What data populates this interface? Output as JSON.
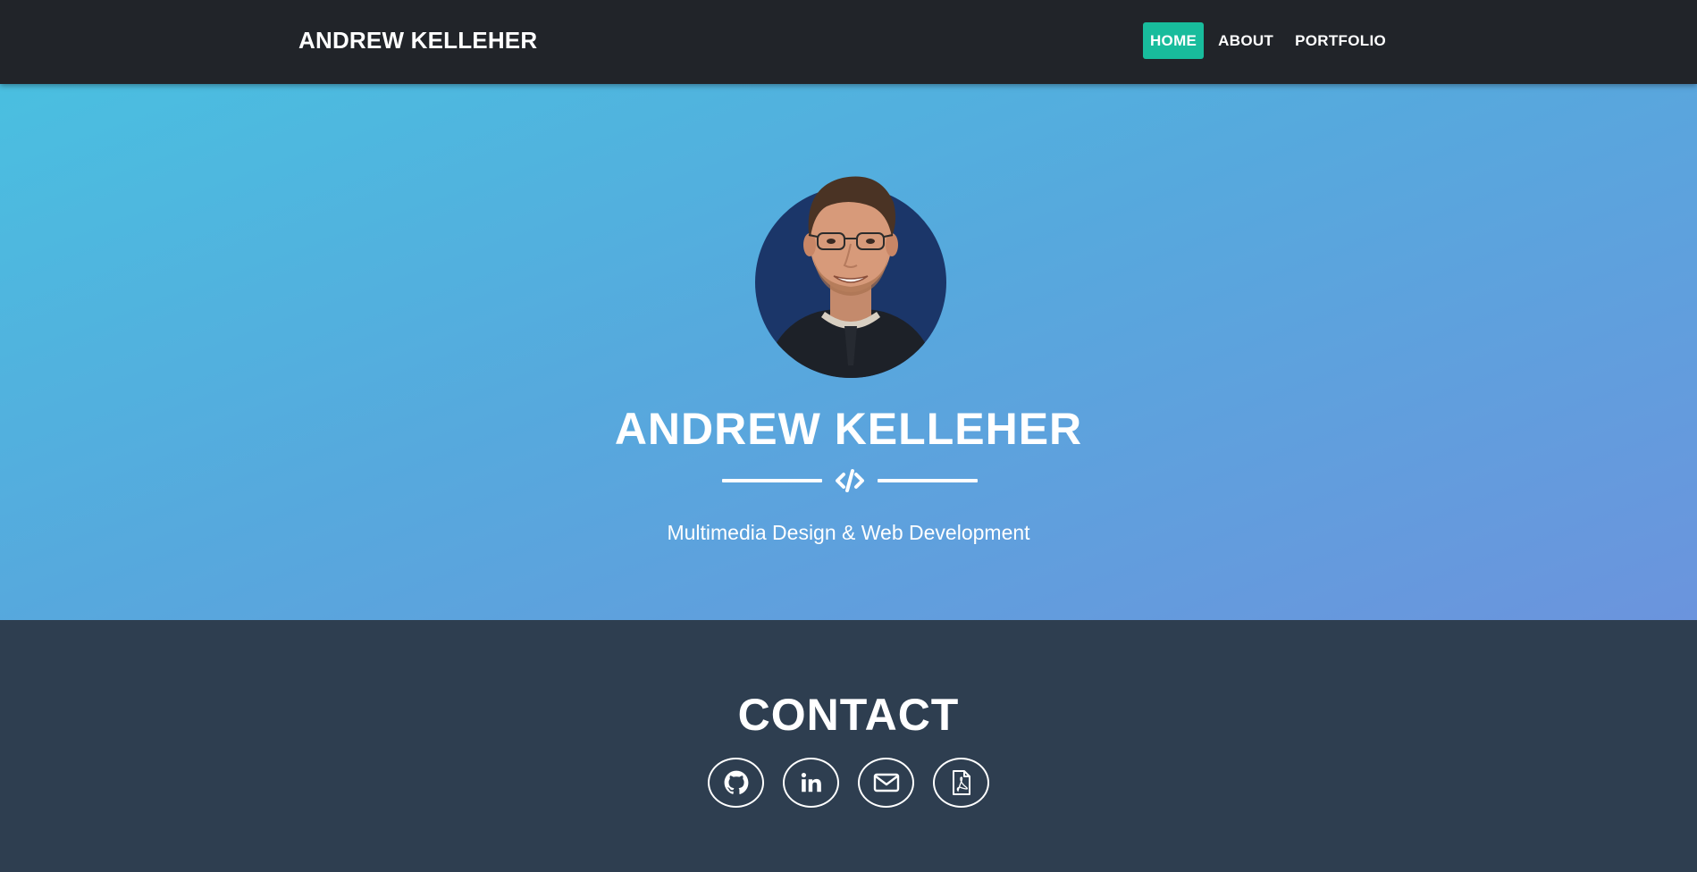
{
  "navbar": {
    "brand": "ANDREW KELLEHER",
    "links": [
      {
        "label": "HOME",
        "active": true
      },
      {
        "label": "ABOUT",
        "active": false
      },
      {
        "label": "PORTFOLIO",
        "active": false
      }
    ]
  },
  "hero": {
    "title": "ANDREW KELLEHER",
    "divider_icon": "code-icon",
    "subtitle": "Multimedia Design & Web Development"
  },
  "contact": {
    "title": "CONTACT",
    "links": [
      {
        "icon": "github-icon"
      },
      {
        "icon": "linkedin-icon"
      },
      {
        "icon": "envelope-icon"
      },
      {
        "icon": "file-pdf-icon"
      }
    ]
  },
  "colors": {
    "navbar_bg": "#212429",
    "active_link_bg": "#18bc9c",
    "hero_gradient_start": "#4abfe0",
    "hero_gradient_end": "#6b94dd",
    "contact_bg": "#2e3e50",
    "text": "#ffffff"
  }
}
